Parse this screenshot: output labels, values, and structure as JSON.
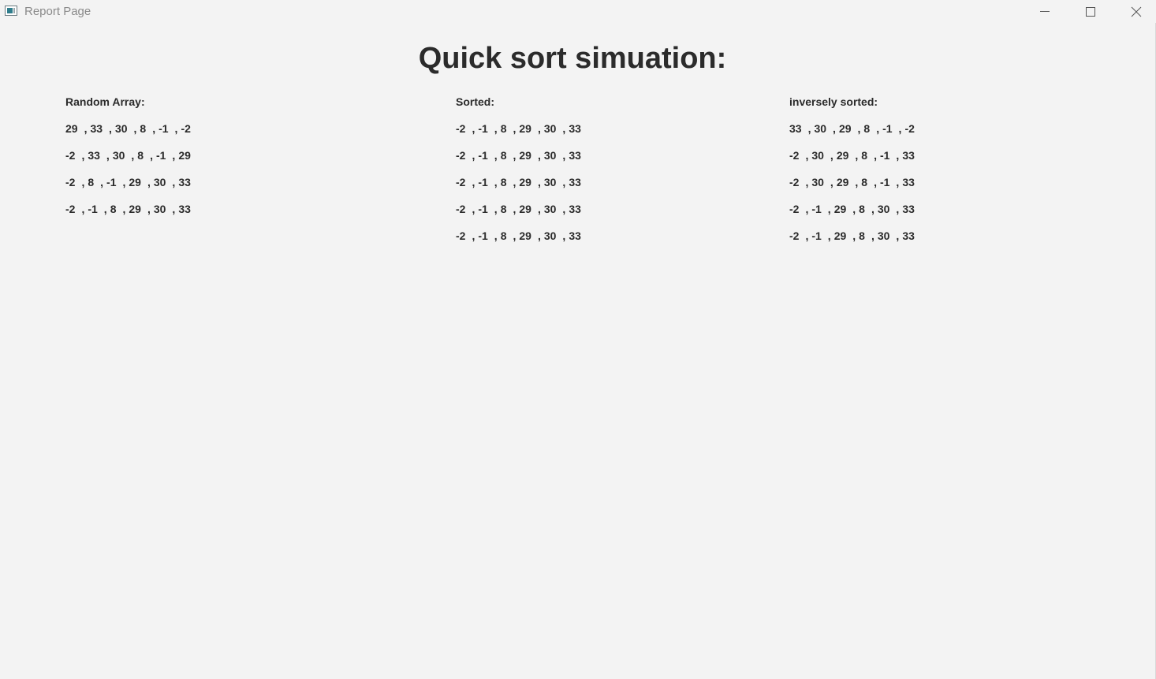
{
  "window": {
    "title": "Report Page",
    "controls": {
      "minimize": "minimize-icon",
      "maximize": "maximize-icon",
      "close": "close-icon"
    }
  },
  "page": {
    "title": "Quick sort simuation:"
  },
  "columns": [
    {
      "heading": "Random Array:",
      "rows": [
        [
          "29",
          "33",
          "30",
          "8",
          "-1",
          "-2"
        ],
        [
          "-2",
          "33",
          "30",
          "8",
          "-1",
          "29"
        ],
        [
          "-2",
          "8",
          "-1",
          "29",
          "30",
          "33"
        ],
        [
          "-2",
          "-1",
          "8",
          "29",
          "30",
          "33"
        ]
      ]
    },
    {
      "heading": "Sorted:",
      "rows": [
        [
          "-2",
          "-1",
          "8",
          "29",
          "30",
          "33"
        ],
        [
          "-2",
          "-1",
          "8",
          "29",
          "30",
          "33"
        ],
        [
          "-2",
          "-1",
          "8",
          "29",
          "30",
          "33"
        ],
        [
          "-2",
          "-1",
          "8",
          "29",
          "30",
          "33"
        ],
        [
          "-2",
          "-1",
          "8",
          "29",
          "30",
          "33"
        ]
      ]
    },
    {
      "heading": "inversely sorted:",
      "rows": [
        [
          "33",
          "30",
          "29",
          "8",
          "-1",
          "-2"
        ],
        [
          "-2",
          "30",
          "29",
          "8",
          "-1",
          "33"
        ],
        [
          "-2",
          "30",
          "29",
          "8",
          "-1",
          "33"
        ],
        [
          "-2",
          "-1",
          "29",
          "8",
          "30",
          "33"
        ],
        [
          "-2",
          "-1",
          "29",
          "8",
          "30",
          "33"
        ]
      ]
    }
  ],
  "separator": ","
}
